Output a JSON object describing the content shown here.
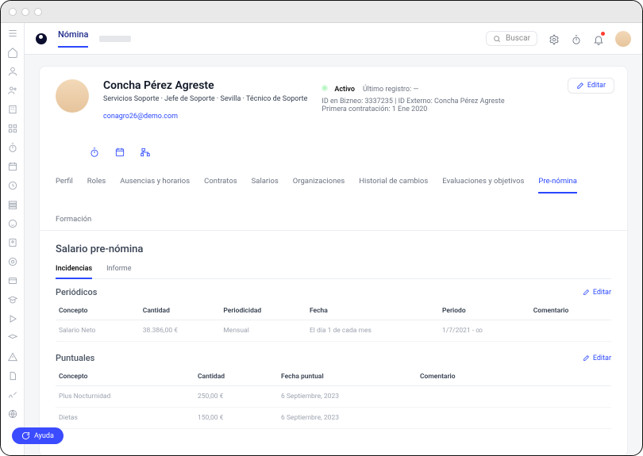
{
  "top": {
    "tab_active": "Nómina",
    "search_placeholder": "Buscar"
  },
  "profile": {
    "name": "Concha Pérez Agreste",
    "subtitle": "Servicios Soporte · Jefe de Soporte · Sevilla · Técnico de Soporte",
    "email": "conagro26@demo.com",
    "status": "Activo",
    "last_login_label": "Último registro: —",
    "id_line": "ID en Bizneo: 3337235  |  ID Externo: Concha Pérez Agreste",
    "hire_line": "Primera contratación: 1 Ene 2020",
    "edit": "Editar"
  },
  "tabs": [
    "Perfil",
    "Roles",
    "Ausencias y horarios",
    "Contratos",
    "Salarios",
    "Organizaciones",
    "Historial de cambios",
    "Evaluaciones y objetivos",
    "Pre-nómina",
    "Formación"
  ],
  "tabs_active_index": 8,
  "panel": {
    "title": "Salario pre-nómina",
    "subtabs": [
      "Incidencias",
      "Informe"
    ],
    "subtab_active_index": 0,
    "edit": "Editar",
    "periodic": {
      "title": "Periódicos",
      "cols": [
        "Concepto",
        "Cantidad",
        "Periodicidad",
        "Fecha",
        "Periodo",
        "Comentario"
      ],
      "rows": [
        {
          "concepto": "Salario Neto",
          "cantidad": "38.386,00 €",
          "periodicidad": "Mensual",
          "fecha": "El día 1 de cada mes",
          "periodo": "1/7/2021 - ∞",
          "comentario": ""
        }
      ]
    },
    "punctual": {
      "title": "Puntuales",
      "cols": [
        "Concepto",
        "Cantidad",
        "Fecha puntual",
        "Comentario"
      ],
      "rows": [
        {
          "concepto": "Plus Nocturnidad",
          "cantidad": "250,00 €",
          "fecha": "6 Septiembre, 2023",
          "comentario": ""
        },
        {
          "concepto": "Dietas",
          "cantidad": "150,00 €",
          "fecha": "6 Septiembre, 2023",
          "comentario": ""
        }
      ]
    }
  },
  "help": "Ayuda"
}
